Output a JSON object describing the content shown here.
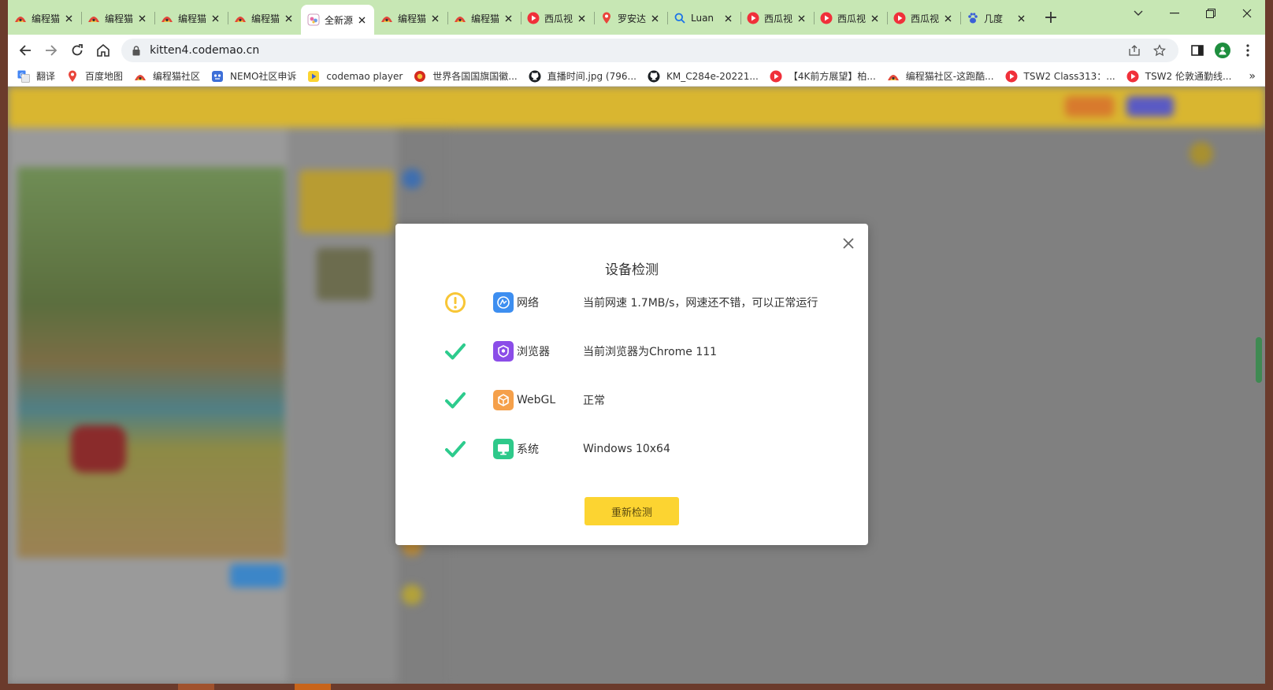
{
  "browser": {
    "tabs": [
      {
        "title": "编程猫",
        "favicon": "codemao-icon",
        "active": false
      },
      {
        "title": "编程猫",
        "favicon": "codemao-icon",
        "active": false
      },
      {
        "title": "编程猫",
        "favicon": "codemao-icon",
        "active": false
      },
      {
        "title": "编程猫",
        "favicon": "codemao-icon",
        "active": false
      },
      {
        "title": "全新源",
        "favicon": "kitten-icon",
        "active": true
      },
      {
        "title": "编程猫",
        "favicon": "codemao-icon",
        "active": false
      },
      {
        "title": "编程猫",
        "favicon": "codemao-icon",
        "active": false
      },
      {
        "title": "西瓜视",
        "favicon": "xigua-icon",
        "active": false
      },
      {
        "title": "罗安达",
        "favicon": "map-pin-icon",
        "active": false
      },
      {
        "title": "Luan",
        "favicon": "search-icon",
        "active": false
      },
      {
        "title": "西瓜视",
        "favicon": "xigua-icon",
        "active": false
      },
      {
        "title": "西瓜视",
        "favicon": "xigua-icon",
        "active": false
      },
      {
        "title": "西瓜视",
        "favicon": "xigua-icon",
        "active": false
      },
      {
        "title": "几度",
        "favicon": "baidu-paw-icon",
        "active": false
      }
    ],
    "url": "kitten4.codemao.cn",
    "bookmarks": [
      {
        "label": "翻译",
        "icon": "translate-icon"
      },
      {
        "label": "百度地图",
        "icon": "map-pin-icon"
      },
      {
        "label": "编程猫社区",
        "icon": "codemao-icon"
      },
      {
        "label": "NEMO社区申诉",
        "icon": "nemo-icon"
      },
      {
        "label": "codemao player",
        "icon": "codemao-player-icon"
      },
      {
        "label": "世界各国国旗国徽...",
        "icon": "emblem-icon"
      },
      {
        "label": "直播时间.jpg (796...",
        "icon": "github-icon"
      },
      {
        "label": "KM_C284e-20221...",
        "icon": "github-icon"
      },
      {
        "label": "【4K前方展望】柏...",
        "icon": "xigua-icon"
      },
      {
        "label": "编程猫社区-这跑酷...",
        "icon": "codemao-icon"
      },
      {
        "label": "TSW2 Class313：...",
        "icon": "xigua-icon"
      },
      {
        "label": "TSW2 伦敦通勤线...",
        "icon": "xigua-icon"
      }
    ],
    "bookmarks_more": "»"
  },
  "dialog": {
    "title": "设备检测",
    "close_label": "×",
    "checks": [
      {
        "status": "warning",
        "icon": "network-icon",
        "icon_color": "#3d8ef0",
        "label": "网络",
        "value": "当前网速 1.7MB/s，网速还不错，可以正常运行"
      },
      {
        "status": "ok",
        "icon": "browser-icon",
        "icon_color": "#8b4de8",
        "label": "浏览器",
        "value": "当前浏览器为Chrome 111"
      },
      {
        "status": "ok",
        "icon": "webgl-icon",
        "icon_color": "#f5a04a",
        "label": "WebGL",
        "value": "正常"
      },
      {
        "status": "ok",
        "icon": "system-icon",
        "icon_color": "#2ec98a",
        "label": "系统",
        "value": "Windows 10x64"
      }
    ],
    "recheck_label": "重新检测"
  },
  "colors": {
    "tabstrip": "#c7e7b4",
    "warning": "#f8c636",
    "ok": "#2dcb8d",
    "primary_button": "#fcd431"
  }
}
